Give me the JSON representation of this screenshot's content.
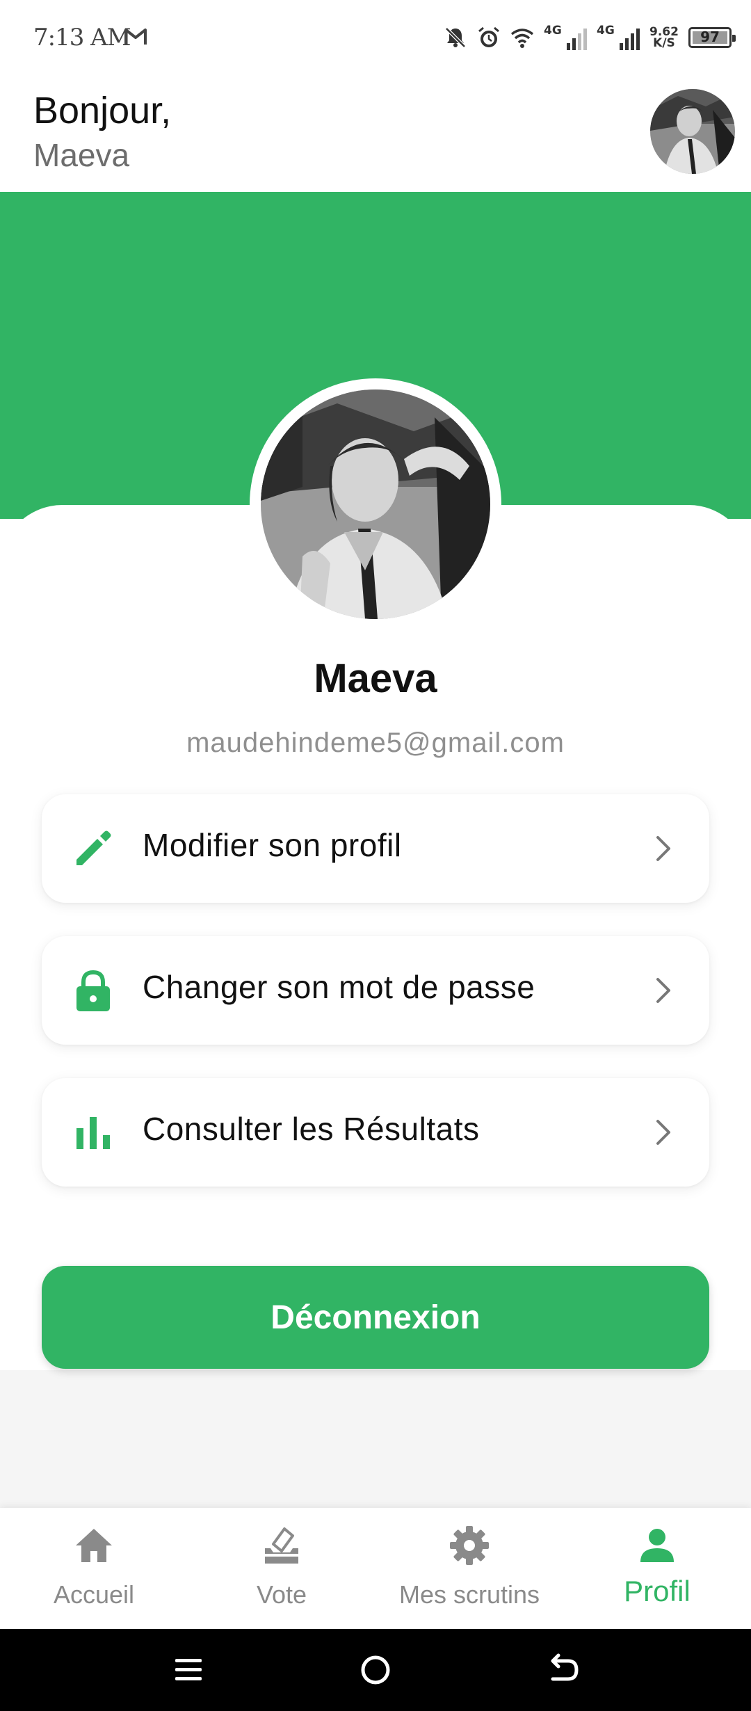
{
  "status_bar": {
    "time": "7:13 AM",
    "net1": "4G",
    "net2": "4G",
    "speed_value": "9.62",
    "speed_unit": "K/S",
    "battery": "97"
  },
  "header": {
    "greeting": "Bonjour,",
    "name": "Maeva"
  },
  "profile": {
    "name": "Maeva",
    "email": "maudehindeme5@gmail.com"
  },
  "menu": {
    "items": [
      {
        "label": "Modifier son profil",
        "icon": "pencil-icon"
      },
      {
        "label": "Changer son mot de passe",
        "icon": "lock-icon"
      },
      {
        "label": "Consulter les Résultats",
        "icon": "bar-chart-icon"
      }
    ]
  },
  "logout_label": "Déconnexion",
  "bottom_nav": {
    "items": [
      {
        "label": "Accueil",
        "icon": "home-icon"
      },
      {
        "label": "Vote",
        "icon": "ballot-box-icon"
      },
      {
        "label": "Mes scrutins",
        "icon": "gear-icon"
      },
      {
        "label": "Profil",
        "icon": "person-icon"
      }
    ],
    "active": "Profil"
  },
  "colors": {
    "accent": "#31b464",
    "inactive_nav": "#8a8a8a",
    "email_text": "#8f8f8f"
  }
}
